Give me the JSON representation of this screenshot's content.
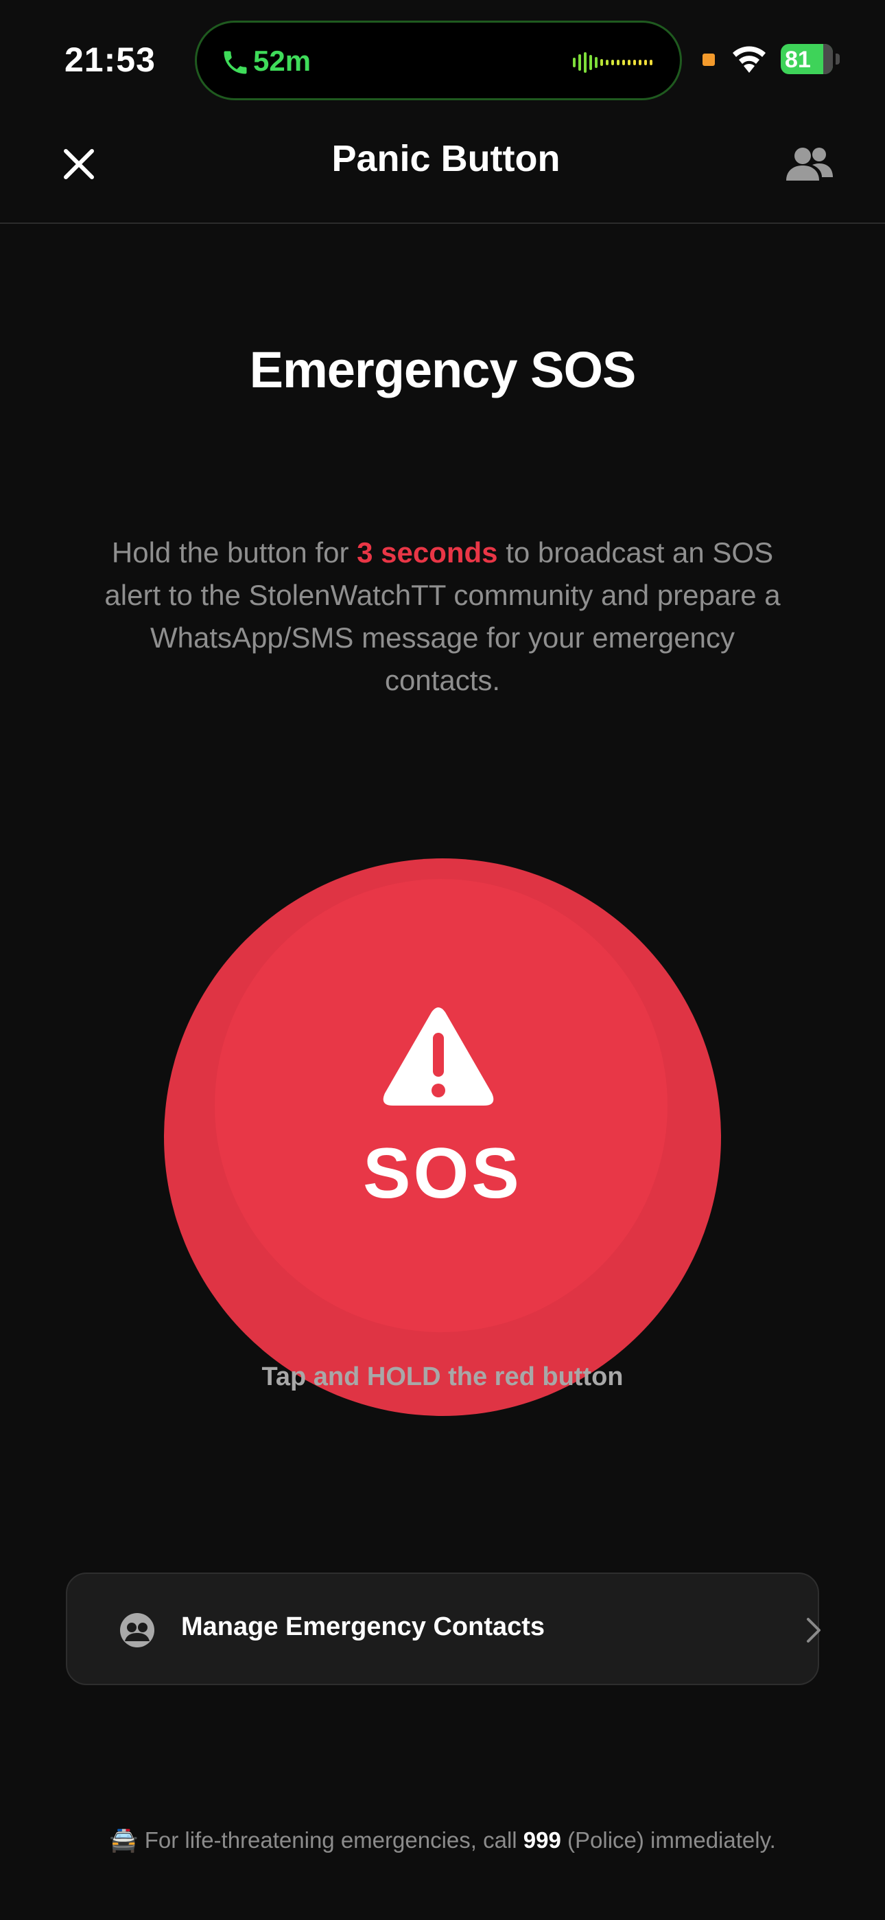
{
  "status_bar": {
    "time": "21:53",
    "call_duration": "52m",
    "battery_level": "81"
  },
  "nav": {
    "title": "Panic Button",
    "close_icon": "close-icon",
    "contacts_icon": "people-icon"
  },
  "content": {
    "heading": "Emergency SOS",
    "description_pre": "Hold the button for ",
    "description_highlight": "3 seconds",
    "description_post": " to broadcast an SOS alert to the StolenWatchTT community and prepare a WhatsApp/SMS message for your emergency contacts.",
    "sos_label": "SOS",
    "hold_hint": "Tap and HOLD the red button"
  },
  "manage_contacts": {
    "label": "Manage Emergency Contacts",
    "icon": "contacts-circle-icon",
    "chevron": "chevron-right-icon"
  },
  "footer": {
    "emoji": "🚔",
    "pre": "For life-threatening emergencies, call ",
    "number": "999",
    "post": " (Police) immediately."
  },
  "colors": {
    "accent_red": "#e83747",
    "call_green": "#3fdc5a",
    "battery_green": "#3ed359",
    "background": "#0d0d0d"
  }
}
